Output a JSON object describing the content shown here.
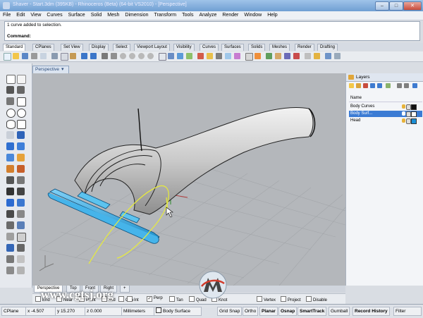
{
  "window": {
    "title": "Shaver - Start.3dm (395KB) - Rhinoceros (Beta) (64-bit VS2010) - [Perspective]",
    "minimize": "–",
    "maximize": "□",
    "close": "✕"
  },
  "menu": [
    "File",
    "Edit",
    "View",
    "Curves",
    "Surface",
    "Solid",
    "Mesh",
    "Dimension",
    "Transform",
    "Tools",
    "Analyze",
    "Render",
    "Window",
    "Help"
  ],
  "command_history": "1 curve added to selection.",
  "command_prompt": "Command:",
  "toolbar_tabs": [
    "Standard",
    "CPlanes",
    "Set View",
    "Display",
    "Select",
    "Viewport Layout",
    "Visibility",
    "Curves",
    "Surfaces",
    "Solids",
    "Meshes",
    "Render",
    "Drafting"
  ],
  "active_toolbar_tab": "Standard",
  "viewport": {
    "title": "Perspective",
    "dropdown_icon": "chevron-down-icon"
  },
  "viewport_tabs": [
    "Perspective",
    "Top",
    "Front",
    "Right",
    "+"
  ],
  "osnaps": [
    {
      "label": "End",
      "checked": false
    },
    {
      "label": "Near",
      "checked": false
    },
    {
      "label": "Point",
      "checked": false
    },
    {
      "label": "Mid",
      "checked": false
    },
    {
      "label": "Cen",
      "checked": false
    },
    {
      "label": "Int",
      "checked": false
    },
    {
      "label": "Perp",
      "checked": true
    },
    {
      "label": "Tan",
      "checked": false
    },
    {
      "label": "Quad",
      "checked": false
    },
    {
      "label": "Knot",
      "checked": false
    },
    {
      "label": "Vertex",
      "checked": false
    },
    {
      "label": "Project",
      "checked": false
    },
    {
      "label": "Disable",
      "checked": false
    }
  ],
  "layers_panel": {
    "title": "Layers",
    "column_name": "Name",
    "layers": [
      {
        "name": "Body Curves",
        "color": "#111111",
        "selected": false,
        "bulb": "#e7b33b"
      },
      {
        "name": "Body Surf...",
        "color": "#ffffff",
        "selected": true,
        "bulb": "#e7b33b"
      },
      {
        "name": "Head",
        "color": "#1a8fd6",
        "selected": false,
        "bulb": "#e7b33b"
      }
    ]
  },
  "status": {
    "cplane": "CPlane",
    "x": "x -4.507",
    "y": "y 15.270",
    "z": "z 0.000",
    "units": "Millimeters",
    "layer": "Body Surface",
    "grid_snap": "Grid Snap",
    "ortho": "Ortho",
    "planar": "Planar",
    "osnap": "Osnap",
    "smarttrack": "SmartTrack",
    "gumball": "Gumball",
    "record_history": "Record History",
    "filter": "Filter"
  },
  "watermark": "www.cgtsj.org",
  "colors": {
    "titlebar": "#7aa7d9",
    "selection": "#3b7bd4",
    "blue_head": "#2aa3e0",
    "yellow_curve": "#e8ec3a"
  }
}
